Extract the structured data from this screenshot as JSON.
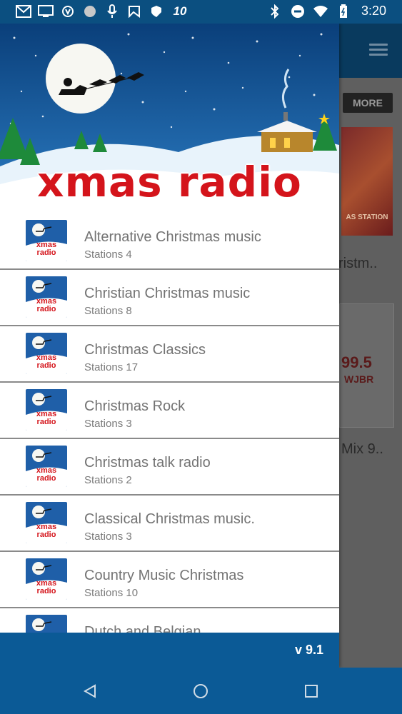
{
  "status_bar": {
    "time": "3:20",
    "left_icons": [
      "gmail-icon",
      "cast-icon",
      "shield-v-icon",
      "radar-icon",
      "mic-icon",
      "check-flag-icon",
      "shield-icon",
      "ten-icon"
    ],
    "right_icons": [
      "bluetooth-icon",
      "dnd-icon",
      "wifi-icon",
      "battery-icon"
    ]
  },
  "background_app": {
    "more_label": "MORE",
    "card1_label": "AS STATION",
    "row1_text": "ristm..",
    "card2_label": "99.5",
    "card2_sub": "WJBR",
    "row2_text": "Mix 9.."
  },
  "drawer": {
    "header_title": "xmas radio",
    "thumb_text": "xmas radio",
    "items": [
      {
        "title": "Alternative Christmas music",
        "subtitle": "Stations 4"
      },
      {
        "title": "Christian Christmas music",
        "subtitle": "Stations 8"
      },
      {
        "title": "Christmas Classics",
        "subtitle": "Stations 17"
      },
      {
        "title": "Christmas Rock",
        "subtitle": "Stations 3"
      },
      {
        "title": "Christmas talk radio",
        "subtitle": "Stations 2"
      },
      {
        "title": "Classical Christmas music.",
        "subtitle": "Stations 3"
      },
      {
        "title": "Country Music Christmas",
        "subtitle": "Stations 10"
      },
      {
        "title": "Dutch and Belgian",
        "subtitle": ""
      }
    ],
    "version": "v 9.1"
  },
  "colors": {
    "primary": "#0b5a96",
    "accent_red": "#d4141b"
  }
}
